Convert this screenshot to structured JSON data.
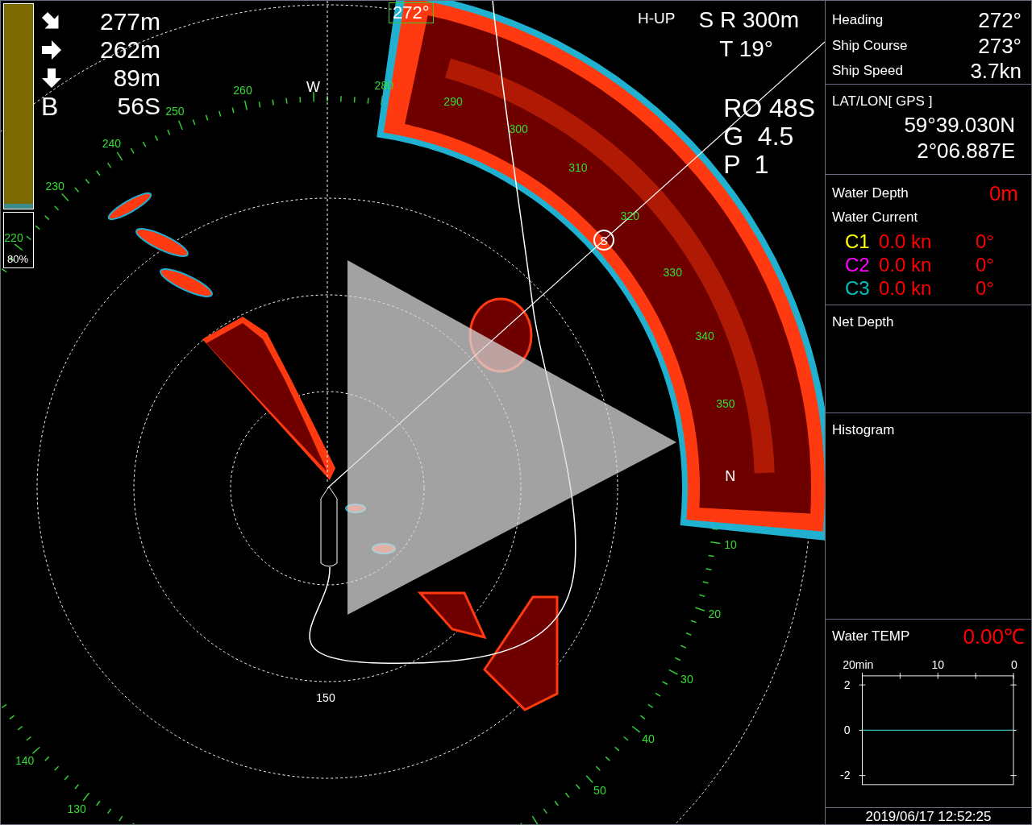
{
  "gain_bar": {
    "reading": "80%"
  },
  "readouts": [
    {
      "kind": "diag",
      "value": "277m"
    },
    {
      "kind": "right",
      "value": "262m"
    },
    {
      "kind": "down",
      "value": "89m"
    },
    {
      "kind": "letter",
      "label": "B",
      "value": "56S"
    }
  ],
  "heading_marker": "272°",
  "mode": "H-UP",
  "range": "S R 300m",
  "tilt": "T 19°",
  "settings": [
    "RO 48S",
    "G  4.5",
    "P  1"
  ],
  "compass": {
    "labels": [
      "130",
      "140",
      "220",
      "230",
      "240",
      "250",
      "260",
      "280",
      "290",
      "300",
      "310",
      "320",
      "330",
      "340",
      "350",
      "10",
      "20",
      "30",
      "40",
      "50"
    ],
    "west": "W",
    "north": "N"
  },
  "range_label": "150",
  "target_marker": "S",
  "navigation": [
    {
      "label": "Heading",
      "value": "272°"
    },
    {
      "label": "Ship Course",
      "value": "273°"
    },
    {
      "label": "Ship Speed",
      "value": "3.7kn"
    }
  ],
  "position": {
    "title": "LAT/LON[ GPS ]",
    "lat": "59°39.030N",
    "lon": "2°06.887E"
  },
  "water_depth": {
    "label": "Water Depth",
    "value": "0m"
  },
  "water_current": {
    "title": "Water Current",
    "rows": [
      {
        "name": "C1",
        "color": "#ffff00",
        "speed": "0.0 kn",
        "direction": "0°"
      },
      {
        "name": "C2",
        "color": "#ff00ff",
        "speed": "0.0 kn",
        "direction": "0°"
      },
      {
        "name": "C3",
        "color": "#00c0c0",
        "speed": "0.0 kn",
        "direction": "0°"
      }
    ]
  },
  "net_depth": {
    "title": "Net Depth"
  },
  "histogram": {
    "title": "Histogram"
  },
  "water_temp": {
    "label": "Water TEMP",
    "value": "0.00℃",
    "chart_data": {
      "type": "line",
      "x": [
        20,
        0
      ],
      "xlim": [
        20,
        0
      ],
      "ylim": [
        -2.4,
        2.4
      ],
      "xticks": [
        {
          "value": 20,
          "label": "20min"
        },
        {
          "value": 10,
          "label": "10"
        },
        {
          "value": 0,
          "label": "0"
        }
      ],
      "yticks": [
        {
          "value": 2,
          "label": "2"
        },
        {
          "value": 0,
          "label": "0"
        },
        {
          "value": -2,
          "label": "-2"
        }
      ],
      "series": [
        {
          "color": "#3cb4b4",
          "values": [
            0,
            0
          ]
        }
      ]
    }
  },
  "timestamp": "2019/06/17 12:52:25"
}
